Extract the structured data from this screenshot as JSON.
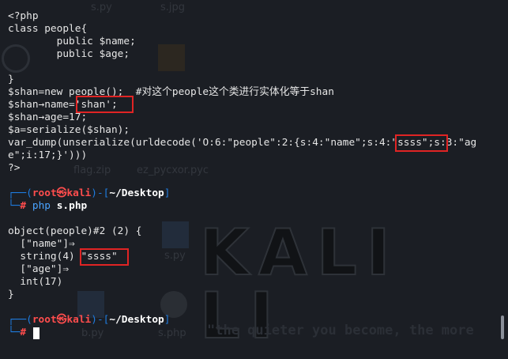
{
  "desktop": {
    "ghost_labels": [
      "s.py",
      "s.jpg",
      "flag.zip",
      "ez_pycxor.pyc",
      "b.py",
      "s.php",
      "s.py"
    ],
    "watermark": "KALI LI",
    "tagline": "\"the quieter you become, the more"
  },
  "terminal": {
    "code": [
      "<?php",
      "class people{",
      "        public $name;",
      "        public $age;",
      "",
      "}",
      "$shan=new people();  #对这个people这个类进行实体化等于shan",
      "$shan→name='shan';",
      "$shan→age=17;",
      "$a=serialize($shan);",
      "var_dump(unserialize(urldecode('O:6:\"people\":2:{s:4:\"name\";s:4:\"ssss\";s:3:\"ag",
      "e\";i:17;}')))",
      "?>"
    ],
    "prompt1": {
      "bar_open": "┌──(",
      "user": "root㉿kali",
      "mid": ")-[",
      "dir": "~/Desktop",
      "close": "]",
      "bar_second": "└─",
      "hash": "#",
      "command": "php",
      "argument": "s.php"
    },
    "output": [
      "object(people)#2 (2) {",
      "  [\"name\"]⇒",
      "  string(4) \"ssss\"",
      "  [\"age\"]⇒",
      "  int(17)",
      "}"
    ],
    "prompt2": {
      "bar_open": "┌──(",
      "user": "root㉿kali",
      "mid": ")-[",
      "dir": "~/Desktop",
      "close": "]",
      "bar_second": "└─",
      "hash": "#"
    }
  },
  "colors": {
    "background": "#1b1e24",
    "text": "#e6e6e6",
    "prompt_bar": "#1f7ce0",
    "prompt_user": "#ff4d4d",
    "highlight_box": "#e02424",
    "command": "#4aa3ff"
  }
}
